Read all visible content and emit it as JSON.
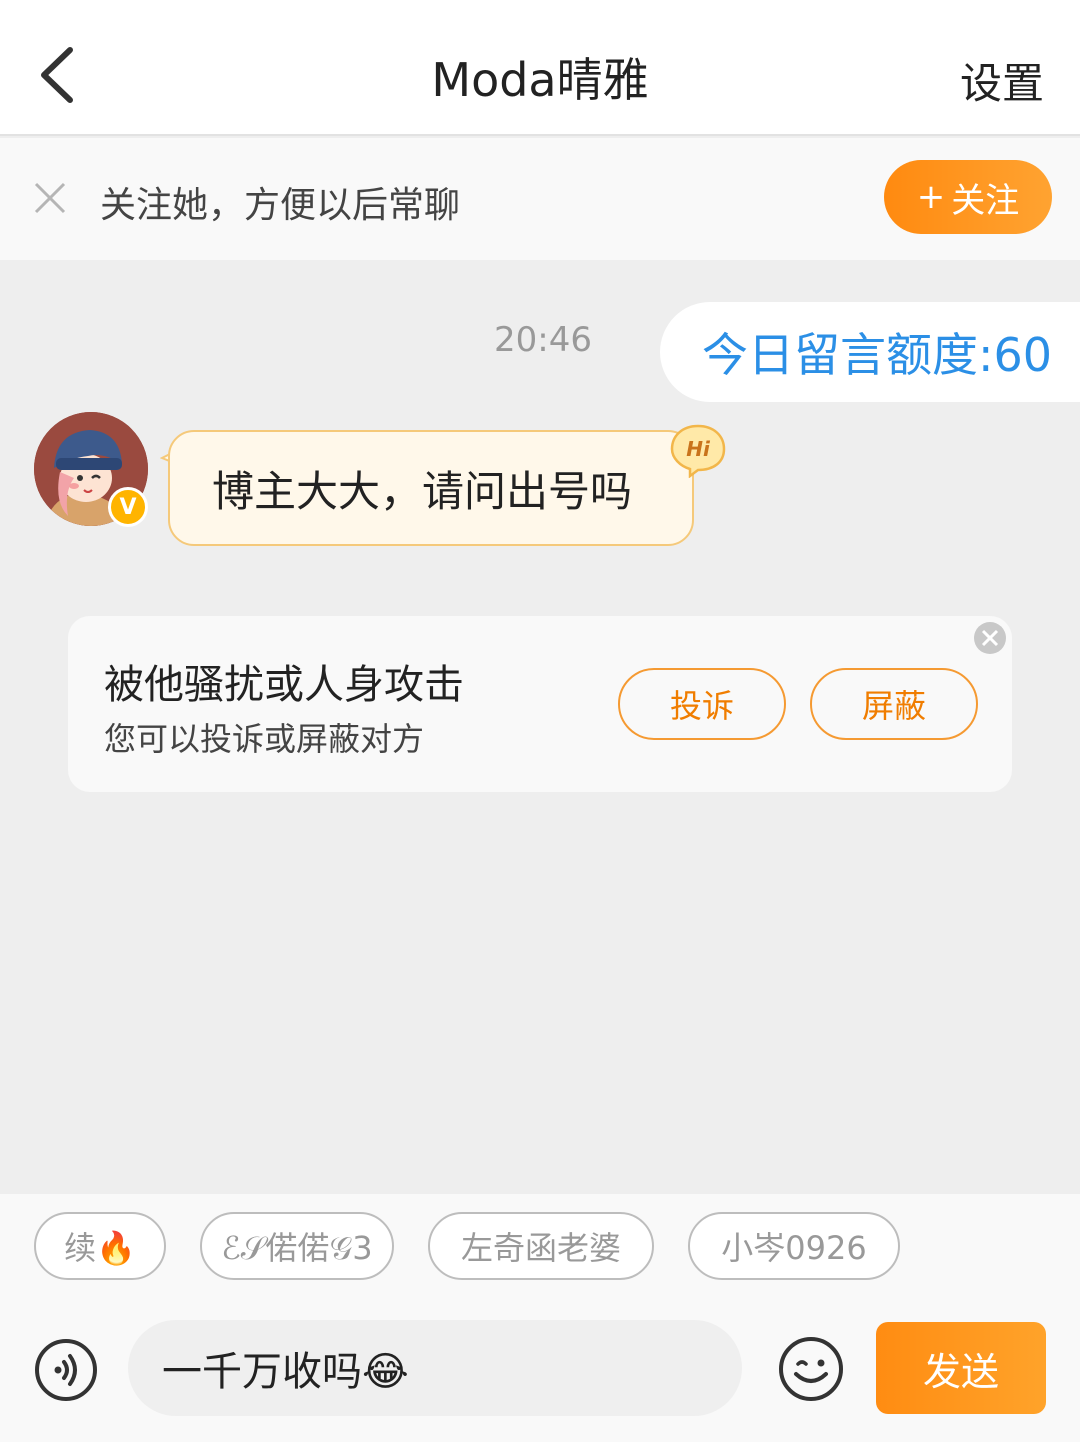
{
  "header": {
    "title": "Moda晴雅",
    "settings_label": "设置"
  },
  "follow_bar": {
    "text": "关注她，方便以后常聊",
    "button_label": "关注",
    "button_plus": "+"
  },
  "chat": {
    "timestamp": "20:46",
    "quota_text": "今日留言额度:60",
    "incoming_message": "博主大大，请问出号吗",
    "hi_badge": "Hi",
    "verified_badge": "V"
  },
  "report_card": {
    "title": "被他骚扰或人身攻击",
    "subtitle": "您可以投诉或屏蔽对方",
    "complain_label": "投诉",
    "block_label": "屏蔽"
  },
  "quick_chips": [
    "续🔥",
    "ℰ𝒮偌偌𝒢3",
    "左奇函老婆",
    "小岑0926"
  ],
  "composer": {
    "input_value": "一千万收吗😂",
    "send_label": "发送"
  },
  "colors": {
    "accent_orange": "#ff8c12",
    "quota_blue": "#2b8fe6"
  },
  "icons": {
    "back": "chevron-left-icon",
    "close": "close-icon",
    "voice": "voice-icon",
    "emoji": "emoji-icon"
  }
}
